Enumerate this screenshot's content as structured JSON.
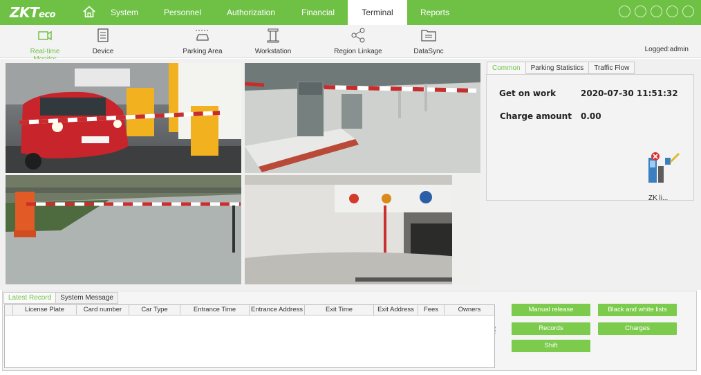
{
  "app": {
    "logo_main": "ZKT",
    "logo_small": "eco"
  },
  "nav": {
    "items": [
      {
        "label": "System"
      },
      {
        "label": "Personnel"
      },
      {
        "label": "Authorization"
      },
      {
        "label": "Financial"
      },
      {
        "label": "Terminal"
      },
      {
        "label": "Reports"
      }
    ],
    "active": "Terminal",
    "window_icons": [
      "settings-icon",
      "info-icon",
      "minimize-icon",
      "maximize-icon",
      "close-icon"
    ]
  },
  "toolbar": {
    "items": [
      {
        "label": "Real-time Monitor",
        "icon": "camera-icon"
      },
      {
        "label": "Device",
        "icon": "device-icon"
      },
      {
        "label": "Parking Area",
        "icon": "car-icon"
      },
      {
        "label": "Workstation",
        "icon": "workstation-icon"
      },
      {
        "label": "Region Linkage",
        "icon": "share-icon"
      },
      {
        "label": "DataSync",
        "icon": "folder-sync-icon"
      }
    ],
    "logged": "Logged:admin"
  },
  "right_panel": {
    "tabs": [
      "Common",
      "Parking Statistics",
      "Traffic Flow"
    ],
    "active_tab": "Common",
    "get_on_work_label": "Get on work",
    "get_on_work_value": "2020-07-30 11:51:32",
    "charge_amount_label": "Charge amount",
    "charge_amount_value": "0.00",
    "device_label": "ZK li..."
  },
  "bottom": {
    "tabs": [
      "Latest Record",
      "System Message"
    ],
    "active_tab": "Latest Record",
    "columns": [
      "License Plate",
      "Card number",
      "Car Type",
      "Entrance Time",
      "Entrance Address",
      "Exit Time",
      "Exit Address",
      "Fees",
      "Owners"
    ],
    "buttons": {
      "manual_release": "Manual release",
      "black_white_lists": "Black and white lists",
      "records": "Records",
      "charges": "Charges",
      "shift": "Shift"
    }
  },
  "colors": {
    "accent": "#6fc146",
    "button": "#7ccb4d"
  }
}
